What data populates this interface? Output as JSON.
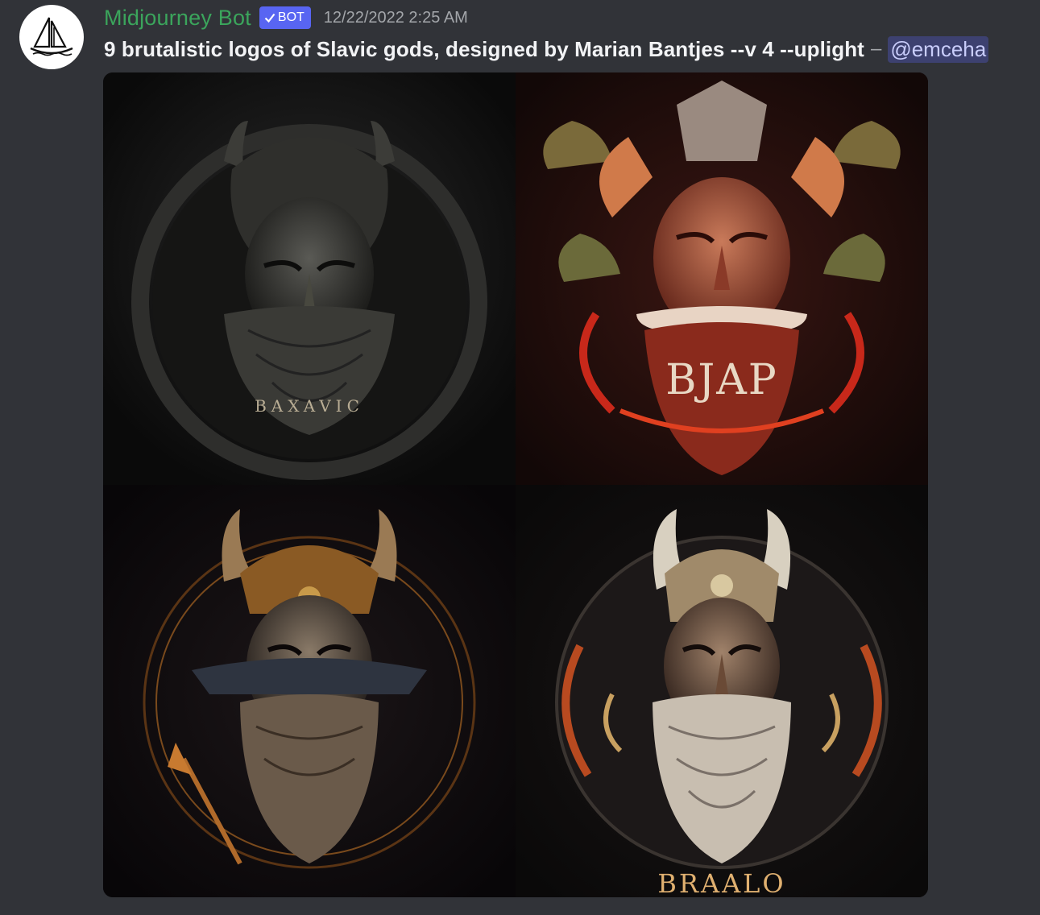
{
  "message": {
    "username": "Midjourney Bot",
    "badge": "BOT",
    "timestamp": "12/22/2022 2:25 AM",
    "prompt": "9 brutalistic logos of Slavic gods, designed by Marian Bantjes --v 4 --uplight",
    "separator": "–",
    "mention": "@emceha"
  },
  "images": [
    {
      "caption": "BAXAVIC"
    },
    {
      "caption": "BJAP"
    },
    {
      "caption": ""
    },
    {
      "caption": "BRAALO"
    }
  ],
  "colors": {
    "username": "#3ba55c",
    "badge": "#5865f2",
    "mention_bg": "#3c4270",
    "background": "#313338"
  }
}
